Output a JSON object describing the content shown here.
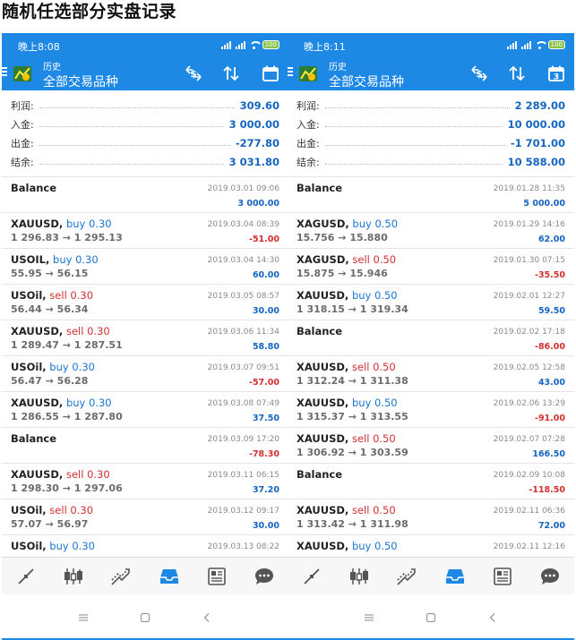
{
  "page_title": "随机任选部分实盘记录",
  "colors": {
    "header": "#1e88e5",
    "profit": "#1565c0",
    "loss": "#d32f2f",
    "buy": "#1976d2",
    "sell": "#d32f2f"
  },
  "bottom_nav_icons": [
    "quotes-icon",
    "chart-icon",
    "trade-icon",
    "history-icon",
    "news-icon",
    "chat-icon"
  ],
  "phones": [
    {
      "status_time": "晚上8:08",
      "battery": "100",
      "header_subtitle": "历史",
      "header_title": "全部交易品种",
      "calendar_day": "",
      "summary": [
        {
          "label": "利润:",
          "value": "309.60"
        },
        {
          "label": "入金:",
          "value": "3 000.00"
        },
        {
          "label": "出金:",
          "value": "-277.80"
        },
        {
          "label": "结余:",
          "value": "3 031.80"
        }
      ],
      "rows": [
        {
          "symbol": "Balance",
          "side": "",
          "side_class": "",
          "price": "",
          "date": "2019.03.01 09:06",
          "pl": "3 000.00",
          "pl_class": "pl-pos"
        },
        {
          "symbol": "XAUUSD,",
          "side": " buy 0.30",
          "side_class": "buy",
          "price": "1 296.83 → 1 295.13",
          "date": "2019.03.04 08:39",
          "pl": "-51.00",
          "pl_class": "pl-neg"
        },
        {
          "symbol": "USOIL,",
          "side": " buy 0.30",
          "side_class": "buy",
          "price": "55.95 → 56.15",
          "date": "2019.03.04 14:30",
          "pl": "60.00",
          "pl_class": "pl-pos"
        },
        {
          "symbol": "USOil,",
          "side": " sell 0.30",
          "side_class": "sell",
          "price": "56.44 → 56.34",
          "date": "2019.03.05 08:57",
          "pl": "30.00",
          "pl_class": "pl-pos"
        },
        {
          "symbol": "XAUUSD,",
          "side": " sell 0.30",
          "side_class": "sell",
          "price": "1 289.47 → 1 287.51",
          "date": "2019.03.06 11:34",
          "pl": "58.80",
          "pl_class": "pl-pos"
        },
        {
          "symbol": "USOil,",
          "side": " buy 0.30",
          "side_class": "buy",
          "price": "56.47 → 56.28",
          "date": "2019.03.07 09:51",
          "pl": "-57.00",
          "pl_class": "pl-neg"
        },
        {
          "symbol": "XAUUSD,",
          "side": " buy 0.30",
          "side_class": "buy",
          "price": "1 286.55 → 1 287.80",
          "date": "2019.03.08 07:49",
          "pl": "37.50",
          "pl_class": "pl-pos"
        },
        {
          "symbol": "Balance",
          "side": "",
          "side_class": "",
          "price": "",
          "date": "2019.03.09 17:20",
          "pl": "-78.30",
          "pl_class": "pl-neg"
        },
        {
          "symbol": "XAUUSD,",
          "side": " sell 0.30",
          "side_class": "sell",
          "price": "1 298.30 → 1 297.06",
          "date": "2019.03.11 06:15",
          "pl": "37.20",
          "pl_class": "pl-pos"
        },
        {
          "symbol": "USOil,",
          "side": " sell 0.30",
          "side_class": "sell",
          "price": "57.07 → 56.97",
          "date": "2019.03.12 09:17",
          "pl": "30.00",
          "pl_class": "pl-pos"
        },
        {
          "symbol": "USOil,",
          "side": " buy 0.30",
          "side_class": "buy",
          "price": "",
          "date": "2019.03.13 08:22",
          "pl": "",
          "pl_class": "pl-pos"
        }
      ]
    },
    {
      "status_time": "晚上8:11",
      "battery": "100",
      "header_subtitle": "历史",
      "header_title": "全部交易品种",
      "calendar_day": "3",
      "summary": [
        {
          "label": "利润:",
          "value": "2 289.00"
        },
        {
          "label": "入金:",
          "value": "10 000.00"
        },
        {
          "label": "出金:",
          "value": "-1 701.00"
        },
        {
          "label": "结余:",
          "value": "10 588.00"
        }
      ],
      "rows": [
        {
          "symbol": "Balance",
          "side": "",
          "side_class": "",
          "price": "",
          "date": "2019.01.28 11:35",
          "pl": "5 000.00",
          "pl_class": "pl-pos"
        },
        {
          "symbol": "XAGUSD,",
          "side": " buy 0.50",
          "side_class": "buy",
          "price": "15.756 → 15.880",
          "date": "2019.01.29 14:16",
          "pl": "62.00",
          "pl_class": "pl-pos"
        },
        {
          "symbol": "XAGUSD,",
          "side": " sell 0.50",
          "side_class": "sell",
          "price": "15.875 → 15.946",
          "date": "2019.01.30 07:15",
          "pl": "-35.50",
          "pl_class": "pl-neg"
        },
        {
          "symbol": "XAUUSD,",
          "side": " buy 0.50",
          "side_class": "buy",
          "price": "1 318.15 → 1 319.34",
          "date": "2019.02.01 12:27",
          "pl": "59.50",
          "pl_class": "pl-pos"
        },
        {
          "symbol": "Balance",
          "side": "",
          "side_class": "",
          "price": "",
          "date": "2019.02.02 17:18",
          "pl": "-86.00",
          "pl_class": "pl-neg"
        },
        {
          "symbol": "XAUUSD,",
          "side": " sell 0.50",
          "side_class": "sell",
          "price": "1 312.24 → 1 311.38",
          "date": "2019.02.05 12:58",
          "pl": "43.00",
          "pl_class": "pl-pos"
        },
        {
          "symbol": "XAUUSD,",
          "side": " buy 0.50",
          "side_class": "buy",
          "price": "1 315.37 → 1 313.55",
          "date": "2019.02.06 13:29",
          "pl": "-91.00",
          "pl_class": "pl-neg"
        },
        {
          "symbol": "XAUUSD,",
          "side": " sell 0.50",
          "side_class": "sell",
          "price": "1 306.92 → 1 303.59",
          "date": "2019.02.07 07:28",
          "pl": "166.50",
          "pl_class": "pl-pos"
        },
        {
          "symbol": "Balance",
          "side": "",
          "side_class": "",
          "price": "",
          "date": "2019.02.09 10:08",
          "pl": "-118.50",
          "pl_class": "pl-neg"
        },
        {
          "symbol": "XAUUSD,",
          "side": " sell 0.50",
          "side_class": "sell",
          "price": "1 313.42 → 1 311.98",
          "date": "2019.02.11 06:36",
          "pl": "72.00",
          "pl_class": "pl-pos"
        },
        {
          "symbol": "XAUUSD,",
          "side": " buy 0.50",
          "side_class": "buy",
          "price": "",
          "date": "2019.02.11 12:16",
          "pl": "",
          "pl_class": "pl-pos"
        }
      ]
    }
  ]
}
